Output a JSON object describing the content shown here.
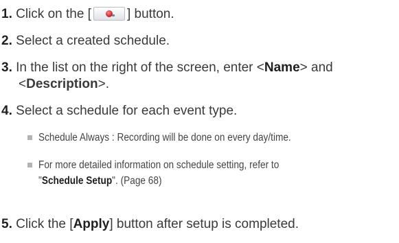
{
  "steps": [
    {
      "number": "1.",
      "before": "Click on the [",
      "after": "] button.",
      "button_icon": "record-icon"
    },
    {
      "number": "2.",
      "text": "Select a created schedule."
    },
    {
      "number": "3.",
      "line1_prefix": "In the list on the right of the screen, enter <",
      "line1_bold": "Name",
      "line1_suffix": "> and",
      "line2_prefix": "<",
      "line2_bold": "Description",
      "line2_suffix": ">."
    },
    {
      "number": "4.",
      "text": "Select a schedule for each event type."
    },
    {
      "number": "5.",
      "before": "Click the [",
      "bold": "Apply",
      "after": "] button after setup is completed."
    }
  ],
  "notes": [
    {
      "text": "Schedule Always : Recording will be done on every day/time."
    },
    {
      "line1": "For more detailed information on schedule setting, refer to",
      "line2_prefix": "\"",
      "line2_bold": "Schedule Setup",
      "line2_suffix": "\". (Page 68)"
    }
  ],
  "colors": {
    "text": "#3a3a3a",
    "bold": "#1f1f1f",
    "bullet": "#b3b3b3",
    "record_dot": "#c4161c"
  }
}
